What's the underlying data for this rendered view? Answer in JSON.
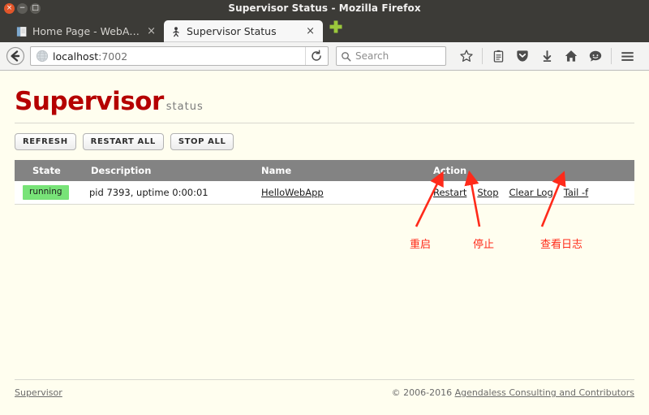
{
  "window": {
    "title": "Supervisor Status - Mozilla Firefox",
    "close_glyph": "×",
    "minimize_glyph": "−",
    "maximize_glyph": "□"
  },
  "tabs": [
    {
      "label": "Home Page - WebAp…",
      "icon": "document-favicon",
      "close_glyph": "×",
      "active": false
    },
    {
      "label": "Supervisor Status",
      "icon": "supervisor-favicon",
      "close_glyph": "×",
      "active": true
    }
  ],
  "newtab_label": "+",
  "navigation": {
    "back_icon": "back-arrow-icon",
    "url_host": "localhost",
    "url_port": ":7002",
    "reload_icon": "reload-icon",
    "search_placeholder": "Search",
    "toolbar_icons": [
      "bookmark-star-icon",
      "reader-list-icon",
      "pocket-icon",
      "downloads-icon",
      "home-icon",
      "sync-chat-icon",
      "hamburger-menu-icon"
    ]
  },
  "brand": {
    "name": "Supervisor",
    "suffix": "status",
    "color": "#b50000"
  },
  "controls": [
    {
      "label": "REFRESH"
    },
    {
      "label": "RESTART ALL"
    },
    {
      "label": "STOP ALL"
    }
  ],
  "table": {
    "headers": [
      "State",
      "Description",
      "Name",
      "Action"
    ],
    "rows": [
      {
        "state": "running",
        "state_color": "#78e378",
        "description": "pid 7393, uptime 0:00:01",
        "name": "HelloWebApp",
        "actions": [
          "Restart",
          "Stop",
          "Clear Log",
          "Tail -f"
        ]
      }
    ]
  },
  "annotations": [
    {
      "text": "重启",
      "color": "#ff2a1a"
    },
    {
      "text": "停止",
      "color": "#ff2a1a"
    },
    {
      "text": "查看日志",
      "color": "#ff2a1a"
    }
  ],
  "footer": {
    "left_link": "Supervisor",
    "copyright": "© 2006-2016 ",
    "right_link": "Agendaless Consulting and Contributors"
  }
}
